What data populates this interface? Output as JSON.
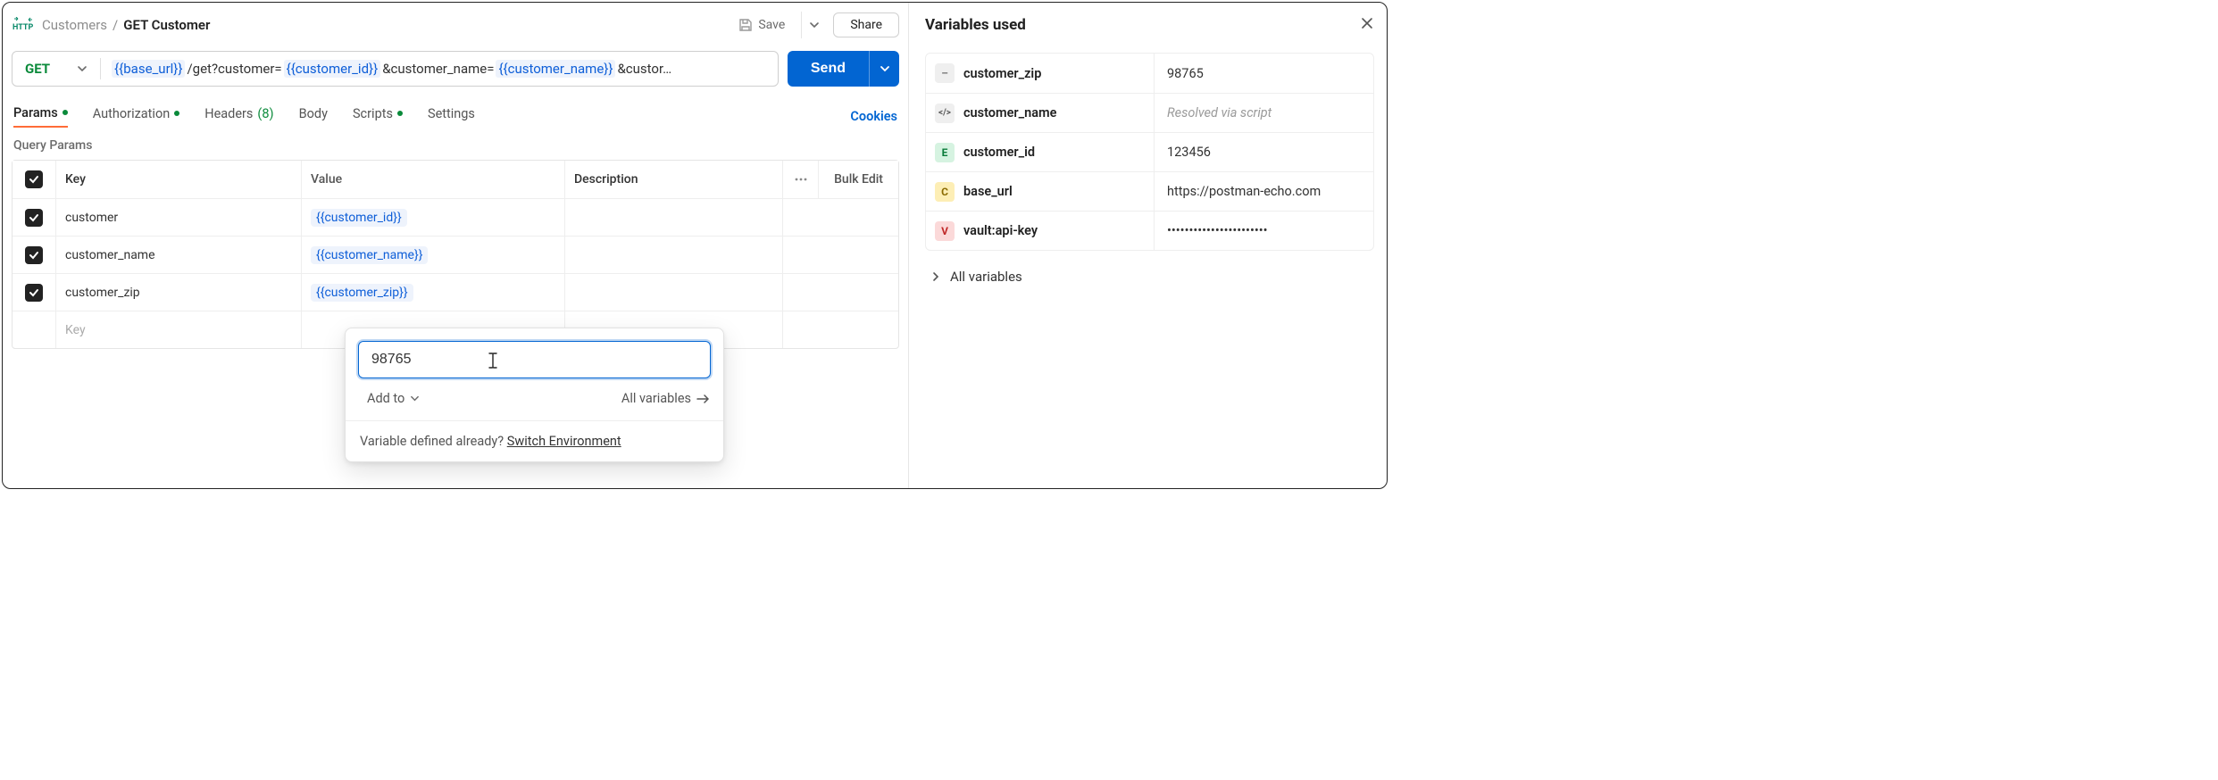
{
  "header": {
    "breadcrumb_parent": "Customers",
    "breadcrumb_current": "GET Customer",
    "save_label": "Save",
    "share_label": "Share"
  },
  "request": {
    "method": "GET",
    "url_tokens": {
      "t1": "{{base_url}}",
      "t2": "/get?customer=",
      "t3": "{{customer_id}}",
      "t4": "&customer_name=",
      "t5": "{{customer_name}}",
      "t6": "&custor…"
    },
    "send_label": "Send"
  },
  "tabs": {
    "params": "Params",
    "authorization": "Authorization",
    "headers": "Headers",
    "headers_count": "(8)",
    "body": "Body",
    "scripts": "Scripts",
    "settings": "Settings",
    "cookies": "Cookies"
  },
  "params_section": {
    "title": "Query Params",
    "head_key": "Key",
    "head_value": "Value",
    "head_description": "Description",
    "bulk_edit": "Bulk Edit",
    "rows": [
      {
        "key": "customer",
        "value": "{{customer_id}}"
      },
      {
        "key": "customer_name",
        "value": "{{customer_name}}"
      },
      {
        "key": "customer_zip",
        "value": "{{customer_zip}}"
      }
    ],
    "new_row_key_placeholder": "Key"
  },
  "popover": {
    "input_value": "98765",
    "add_to_label": "Add to",
    "all_variables_label": "All variables",
    "footer_prompt": "Variable defined already? ",
    "footer_link": "Switch Environment"
  },
  "side_panel": {
    "title": "Variables used",
    "rows": [
      {
        "badge": "–",
        "badge_class": "b-grey",
        "name": "customer_zip",
        "value": "98765"
      },
      {
        "badge": "</>",
        "badge_class": "b-code",
        "name": "customer_name",
        "value": "Resolved via script",
        "muted": true
      },
      {
        "badge": "E",
        "badge_class": "b-green",
        "name": "customer_id",
        "value": "123456"
      },
      {
        "badge": "C",
        "badge_class": "b-yellow",
        "name": "base_url",
        "value": "https://postman-echo.com"
      },
      {
        "badge": "V",
        "badge_class": "b-red",
        "name": "vault:api-key",
        "value": "•••••••••••••••••••••••"
      }
    ],
    "all_variables_label": "All variables"
  }
}
